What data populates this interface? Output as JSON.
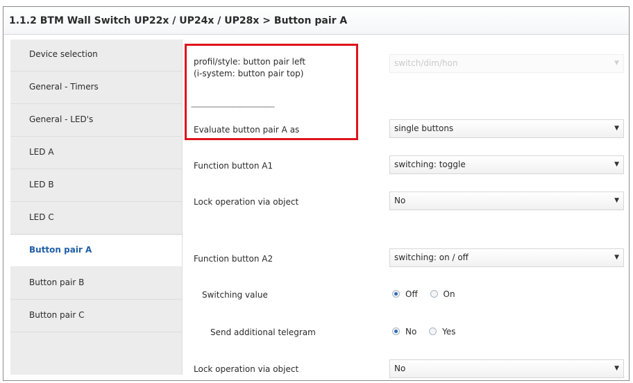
{
  "title": "1.1.2 BTM Wall Switch UP22x / UP24x / UP28x > Button pair A",
  "sidebar": {
    "items": [
      {
        "label": "Device selection"
      },
      {
        "label": "General - Timers"
      },
      {
        "label": "General - LED's"
      },
      {
        "label": "LED A"
      },
      {
        "label": "LED B"
      },
      {
        "label": "LED C"
      },
      {
        "label": "Button pair A",
        "active": true
      },
      {
        "label": "Button pair B"
      },
      {
        "label": "Button pair C"
      }
    ]
  },
  "params": {
    "profile_label_line1": "profil/style: button pair left",
    "profile_label_line2": "(i-system: button pair top)",
    "profile_value": "switch/dim/hon",
    "separator": "----------------------------------------------",
    "evaluate_label": "Evaluate button pair A as",
    "evaluate_value": "single buttons",
    "func_a1_label": "Function button A1",
    "func_a1_value": "switching: toggle",
    "lock1_label": "Lock operation via object",
    "lock1_value": "No",
    "func_a2_label": "Function button A2",
    "func_a2_value": "switching: on / off",
    "switching_value_label": "Switching value",
    "switching_value_options": [
      "Off",
      "On"
    ],
    "switching_value_selected": "Off",
    "telegram_label": "Send additional telegram",
    "telegram_options": [
      "No",
      "Yes"
    ],
    "telegram_selected": "No",
    "lock2_label": "Lock operation via object",
    "lock2_value": "No"
  },
  "colors": {
    "highlight_border": "#e0121b",
    "active_nav_text": "#1f5fa8"
  },
  "icons": {
    "dropdown": "chevron-down-icon",
    "radio": "radio-button"
  }
}
